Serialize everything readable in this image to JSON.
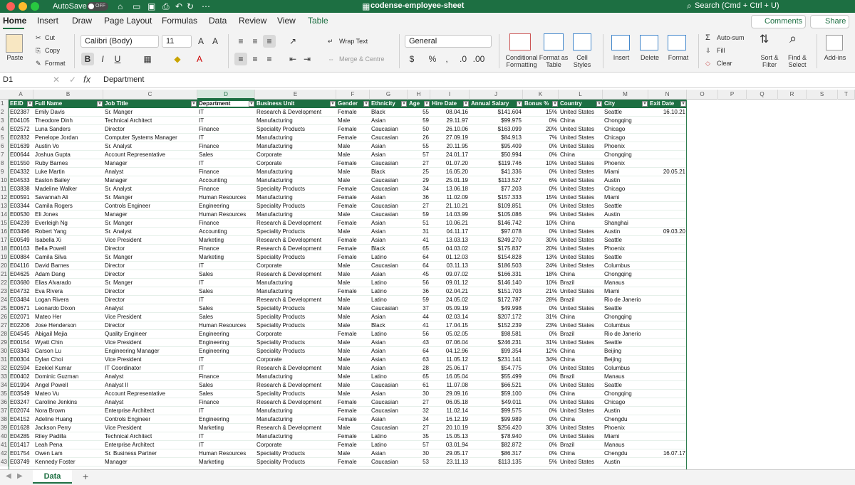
{
  "titlebar": {
    "autosave_label": "AutoSave",
    "autosave_state": "OFF",
    "doc_title": "codense-employee-sheet",
    "search_placeholder": "Search (Cmd + Ctrl + U)"
  },
  "tabs": [
    "Home",
    "Insert",
    "Draw",
    "Page Layout",
    "Formulas",
    "Data",
    "Review",
    "View",
    "Table"
  ],
  "header_buttons": {
    "comments": "Comments",
    "share": "Share"
  },
  "ribbon": {
    "paste": "Paste",
    "cut": "Cut",
    "copy": "Copy",
    "format": "Format",
    "font_name": "Calibri (Body)",
    "font_size": "11",
    "wrap_text": "Wrap Text",
    "merge_centre": "Merge & Centre",
    "number_format": "General",
    "conditional_formatting": "Conditional Formatting",
    "format_as_table": "Format as Table",
    "cell_styles": "Cell Styles",
    "insert": "Insert",
    "delete": "Delete",
    "format_cells": "Format",
    "auto_sum": "Auto-sum",
    "fill": "Fill",
    "clear": "Clear",
    "sort_filter": "Sort & Filter",
    "find_select": "Find & Select",
    "add_ins": "Add-ins"
  },
  "formula_bar": {
    "cell_ref": "D1",
    "content": "Department"
  },
  "columns": [
    "A",
    "B",
    "C",
    "D",
    "E",
    "F",
    "G",
    "H",
    "I",
    "J",
    "K",
    "L",
    "M",
    "N",
    "O",
    "P",
    "Q",
    "R",
    "S",
    "T"
  ],
  "headers": [
    "EEID",
    "Full Name",
    "Job Title",
    "Department",
    "Business Unit",
    "Gender",
    "Ethnicity",
    "Age",
    "Hire Date",
    "Annual Salary",
    "Bonus %",
    "Country",
    "City",
    "Exit Date"
  ],
  "rows": [
    [
      "E02387",
      "Emily Davis",
      "Sr. Manger",
      "IT",
      "Research & Development",
      "Female",
      "Black",
      "55",
      "08.04.16",
      "$141.604",
      "15%",
      "United States",
      "Seattle",
      "16.10.21"
    ],
    [
      "E04105",
      "Theodore Dinh",
      "Technical Architect",
      "IT",
      "Manufacturing",
      "Male",
      "Asian",
      "59",
      "29.11.97",
      "$99.975",
      "0%",
      "China",
      "Chongqing",
      ""
    ],
    [
      "E02572",
      "Luna Sanders",
      "Director",
      "Finance",
      "Speciality Products",
      "Female",
      "Caucasian",
      "50",
      "26.10.06",
      "$163.099",
      "20%",
      "United States",
      "Chicago",
      ""
    ],
    [
      "E02832",
      "Penelope Jordan",
      "Computer Systems Manager",
      "IT",
      "Manufacturing",
      "Female",
      "Caucasian",
      "26",
      "27.09.19",
      "$84.913",
      "7%",
      "United States",
      "Chicago",
      ""
    ],
    [
      "E01639",
      "Austin Vo",
      "Sr. Analyst",
      "Finance",
      "Manufacturing",
      "Male",
      "Asian",
      "55",
      "20.11.95",
      "$95.409",
      "0%",
      "United States",
      "Phoenix",
      ""
    ],
    [
      "E00644",
      "Joshua Gupta",
      "Account Representative",
      "Sales",
      "Corporate",
      "Male",
      "Asian",
      "57",
      "24.01.17",
      "$50.994",
      "0%",
      "China",
      "Chongqing",
      ""
    ],
    [
      "E01550",
      "Ruby Barnes",
      "Manager",
      "IT",
      "Corporate",
      "Female",
      "Caucasian",
      "27",
      "01.07.20",
      "$119.746",
      "10%",
      "United States",
      "Phoenix",
      ""
    ],
    [
      "E04332",
      "Luke Martin",
      "Analyst",
      "Finance",
      "Manufacturing",
      "Male",
      "Black",
      "25",
      "16.05.20",
      "$41.336",
      "0%",
      "United States",
      "Miami",
      "20.05.21"
    ],
    [
      "E04533",
      "Easton Bailey",
      "Manager",
      "Accounting",
      "Manufacturing",
      "Male",
      "Caucasian",
      "29",
      "25.01.19",
      "$113.527",
      "6%",
      "United States",
      "Austin",
      ""
    ],
    [
      "E03838",
      "Madeline Walker",
      "Sr. Analyst",
      "Finance",
      "Speciality Products",
      "Female",
      "Caucasian",
      "34",
      "13.06.18",
      "$77.203",
      "0%",
      "United States",
      "Chicago",
      ""
    ],
    [
      "E00591",
      "Savannah Ali",
      "Sr. Manger",
      "Human Resources",
      "Manufacturing",
      "Female",
      "Asian",
      "36",
      "11.02.09",
      "$157.333",
      "15%",
      "United States",
      "Miami",
      ""
    ],
    [
      "E03344",
      "Camila Rogers",
      "Controls Engineer",
      "Engineering",
      "Speciality Products",
      "Female",
      "Caucasian",
      "27",
      "21.10.21",
      "$109.851",
      "0%",
      "United States",
      "Seattle",
      ""
    ],
    [
      "E00530",
      "Eli Jones",
      "Manager",
      "Human Resources",
      "Manufacturing",
      "Male",
      "Caucasian",
      "59",
      "14.03.99",
      "$105.086",
      "9%",
      "United States",
      "Austin",
      ""
    ],
    [
      "E04239",
      "Everleigh Ng",
      "Sr. Manger",
      "Finance",
      "Research & Development",
      "Female",
      "Asian",
      "51",
      "10.06.21",
      "$146.742",
      "10%",
      "China",
      "Shanghai",
      ""
    ],
    [
      "E03496",
      "Robert Yang",
      "Sr. Analyst",
      "Accounting",
      "Speciality Products",
      "Male",
      "Asian",
      "31",
      "04.11.17",
      "$97.078",
      "0%",
      "United States",
      "Austin",
      "09.03.20"
    ],
    [
      "E00549",
      "Isabella Xi",
      "Vice President",
      "Marketing",
      "Research & Development",
      "Female",
      "Asian",
      "41",
      "13.03.13",
      "$249.270",
      "30%",
      "United States",
      "Seattle",
      ""
    ],
    [
      "E00163",
      "Bella Powell",
      "Director",
      "Finance",
      "Research & Development",
      "Female",
      "Black",
      "65",
      "04.03.02",
      "$175.837",
      "20%",
      "United States",
      "Phoenix",
      ""
    ],
    [
      "E00884",
      "Camila Silva",
      "Sr. Manger",
      "Marketing",
      "Speciality Products",
      "Female",
      "Latino",
      "64",
      "01.12.03",
      "$154.828",
      "13%",
      "United States",
      "Seattle",
      ""
    ],
    [
      "E04116",
      "David Barnes",
      "Director",
      "IT",
      "Corporate",
      "Male",
      "Caucasian",
      "64",
      "03.11.13",
      "$186.503",
      "24%",
      "United States",
      "Columbus",
      ""
    ],
    [
      "E04625",
      "Adam Dang",
      "Director",
      "Sales",
      "Research & Development",
      "Male",
      "Asian",
      "45",
      "09.07.02",
      "$166.331",
      "18%",
      "China",
      "Chongqing",
      ""
    ],
    [
      "E03680",
      "Elias Alvarado",
      "Sr. Manger",
      "IT",
      "Manufacturing",
      "Male",
      "Latino",
      "56",
      "09.01.12",
      "$146.140",
      "10%",
      "Brazil",
      "Manaus",
      ""
    ],
    [
      "E04732",
      "Eva Rivera",
      "Director",
      "Sales",
      "Manufacturing",
      "Female",
      "Latino",
      "36",
      "02.04.21",
      "$151.703",
      "21%",
      "United States",
      "Miami",
      ""
    ],
    [
      "E03484",
      "Logan Rivera",
      "Director",
      "IT",
      "Research & Development",
      "Male",
      "Latino",
      "59",
      "24.05.02",
      "$172.787",
      "28%",
      "Brazil",
      "Rio de Janerio",
      ""
    ],
    [
      "E00671",
      "Leonardo Dixon",
      "Analyst",
      "Sales",
      "Speciality Products",
      "Male",
      "Caucasian",
      "37",
      "05.09.19",
      "$49.998",
      "0%",
      "United States",
      "Seattle",
      ""
    ],
    [
      "E02071",
      "Mateo Her",
      "Vice President",
      "Sales",
      "Speciality Products",
      "Male",
      "Asian",
      "44",
      "02.03.14",
      "$207.172",
      "31%",
      "China",
      "Chongqing",
      ""
    ],
    [
      "E02206",
      "Jose Henderson",
      "Director",
      "Human Resources",
      "Speciality Products",
      "Male",
      "Black",
      "41",
      "17.04.15",
      "$152.239",
      "23%",
      "United States",
      "Columbus",
      ""
    ],
    [
      "E04545",
      "Abigail Mejia",
      "Quality Engineer",
      "Engineering",
      "Corporate",
      "Female",
      "Latino",
      "56",
      "05.02.05",
      "$98.581",
      "0%",
      "Brazil",
      "Rio de Janerio",
      ""
    ],
    [
      "E00154",
      "Wyatt Chin",
      "Vice President",
      "Engineering",
      "Speciality Products",
      "Male",
      "Asian",
      "43",
      "07.06.04",
      "$246.231",
      "31%",
      "United States",
      "Seattle",
      ""
    ],
    [
      "E03343",
      "Carson Lu",
      "Engineering Manager",
      "Engineering",
      "Speciality Products",
      "Male",
      "Asian",
      "64",
      "04.12.96",
      "$99.354",
      "12%",
      "China",
      "Beijing",
      ""
    ],
    [
      "E00304",
      "Dylan Choi",
      "Vice President",
      "IT",
      "Corporate",
      "Male",
      "Asian",
      "63",
      "11.05.12",
      "$231.141",
      "34%",
      "China",
      "Beijing",
      ""
    ],
    [
      "E02594",
      "Ezekiel Kumar",
      "IT Coordinator",
      "IT",
      "Research & Development",
      "Male",
      "Asian",
      "28",
      "25.06.17",
      "$54.775",
      "0%",
      "United States",
      "Columbus",
      ""
    ],
    [
      "E00402",
      "Dominic Guzman",
      "Analyst",
      "Finance",
      "Manufacturing",
      "Male",
      "Latino",
      "65",
      "16.05.04",
      "$55.499",
      "0%",
      "Brazil",
      "Manaus",
      ""
    ],
    [
      "E01994",
      "Angel Powell",
      "Analyst II",
      "Sales",
      "Research & Development",
      "Male",
      "Caucasian",
      "61",
      "11.07.08",
      "$66.521",
      "0%",
      "United States",
      "Seattle",
      ""
    ],
    [
      "E03549",
      "Mateo Vu",
      "Account Representative",
      "Sales",
      "Speciality Products",
      "Male",
      "Asian",
      "30",
      "29.09.16",
      "$59.100",
      "0%",
      "China",
      "Chongqing",
      ""
    ],
    [
      "E03247",
      "Caroline Jenkins",
      "Analyst",
      "Finance",
      "Research & Development",
      "Female",
      "Caucasian",
      "27",
      "06.05.18",
      "$49.011",
      "0%",
      "United States",
      "Chicago",
      ""
    ],
    [
      "E02074",
      "Nora Brown",
      "Enterprise Architect",
      "IT",
      "Manufacturing",
      "Female",
      "Caucasian",
      "32",
      "11.02.14",
      "$99.575",
      "0%",
      "United States",
      "Austin",
      ""
    ],
    [
      "E04152",
      "Adeline Huang",
      "Controls Engineer",
      "Engineering",
      "Manufacturing",
      "Female",
      "Asian",
      "34",
      "16.12.19",
      "$99.989",
      "0%",
      "China",
      "Chengdu",
      ""
    ],
    [
      "E01628",
      "Jackson Perry",
      "Vice President",
      "Marketing",
      "Research & Development",
      "Male",
      "Caucasian",
      "27",
      "20.10.19",
      "$256.420",
      "30%",
      "United States",
      "Phoenix",
      ""
    ],
    [
      "E04285",
      "Riley Padilla",
      "Technical Architect",
      "IT",
      "Manufacturing",
      "Female",
      "Latino",
      "35",
      "15.05.13",
      "$78.940",
      "0%",
      "United States",
      "Miami",
      ""
    ],
    [
      "E01417",
      "Leah Pena",
      "Enterprise Architect",
      "IT",
      "Corporate",
      "Female",
      "Latino",
      "57",
      "03.01.94",
      "$82.872",
      "0%",
      "Brazil",
      "Manaus",
      ""
    ],
    [
      "E01754",
      "Owen Lam",
      "Sr. Business Partner",
      "Human Resources",
      "Speciality Products",
      "Male",
      "Asian",
      "30",
      "29.05.17",
      "$86.317",
      "0%",
      "China",
      "Chengdu",
      "16.07.17"
    ],
    [
      "E03749",
      "Kennedy Foster",
      "Manager",
      "Marketing",
      "Speciality Products",
      "Female",
      "Caucasian",
      "53",
      "23.11.13",
      "$113.135",
      "5%",
      "United States",
      "Austin",
      ""
    ]
  ],
  "sheet_tab": "Data",
  "add_sheet": "+"
}
